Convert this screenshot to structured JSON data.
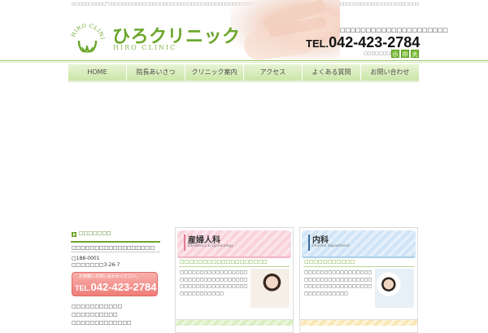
{
  "header": {
    "tagline": "□□□□□□□□□□\"□□□□□□□□□□□□□□□□□□□□□□□□□□□□□□□□□□□□□□□□□□□□□□□□□□□□□□□□□□□□□□□□□□□□□□□□□□□□□□□□□□□□□□□□□□",
    "logo_name": "ひろクリニック",
    "logo_en": "HIRO CLINIC",
    "emblem_text": "HIRO CLINIC",
    "address": "□□□□□□□□□□□□□□□□□□□□□",
    "tel_prefix": "TEL.",
    "tel_number": "042-423-2784",
    "font_size_label": "□□□□□□□□",
    "font_size_buttons": [
      "小",
      "中",
      "大"
    ]
  },
  "nav": {
    "items": [
      "HOME",
      "院長あいさつ",
      "クリニック案内",
      "アクセス",
      "よくある質問",
      "お問い合わせ"
    ]
  },
  "sidebar": {
    "heading": "□□□□□□□",
    "clinic_name": "□□□□□□□□□□□□□□□□□□",
    "zip": "□188-0001",
    "address": "□□□□□□□3-26-7",
    "tel_banner_caption": "お気軽にお問い合わせください。",
    "tel_banner_prefix": "TEL.",
    "tel_banner_number": "042-423-2784",
    "links": [
      "□□□□□□□□□□□",
      "□□□□□□□□□□",
      "□□□□□□□□□□□□□"
    ]
  },
  "departments": [
    {
      "title": "産婦人科",
      "subtitle": "Obstetrics & Gynecology",
      "catch": "□□□□□□□□□□□□□□□□□□□",
      "text": "□□□□□□□□□□□□□□□□□□□□□□□□□□□□□□□□□□□□□□□□□□□□□□□□□□□□□□□□□□□□□□"
    },
    {
      "title": "内科",
      "subtitle": "Internal department",
      "catch": "□□□□□□□□□□□",
      "text": "□□□□□□□□□□□□□□□□□□□□□□□□□□□□□□□□□□□□□□□□□□□□□□□□□□□□□□□□□□□□□□"
    }
  ],
  "colors": {
    "brand_green": "#6aa62a",
    "nav_green": "#cbe6a7",
    "tel_pink": "#ef7d78",
    "card_pink": "#fce4ea",
    "card_blue": "#e3f0fb"
  }
}
